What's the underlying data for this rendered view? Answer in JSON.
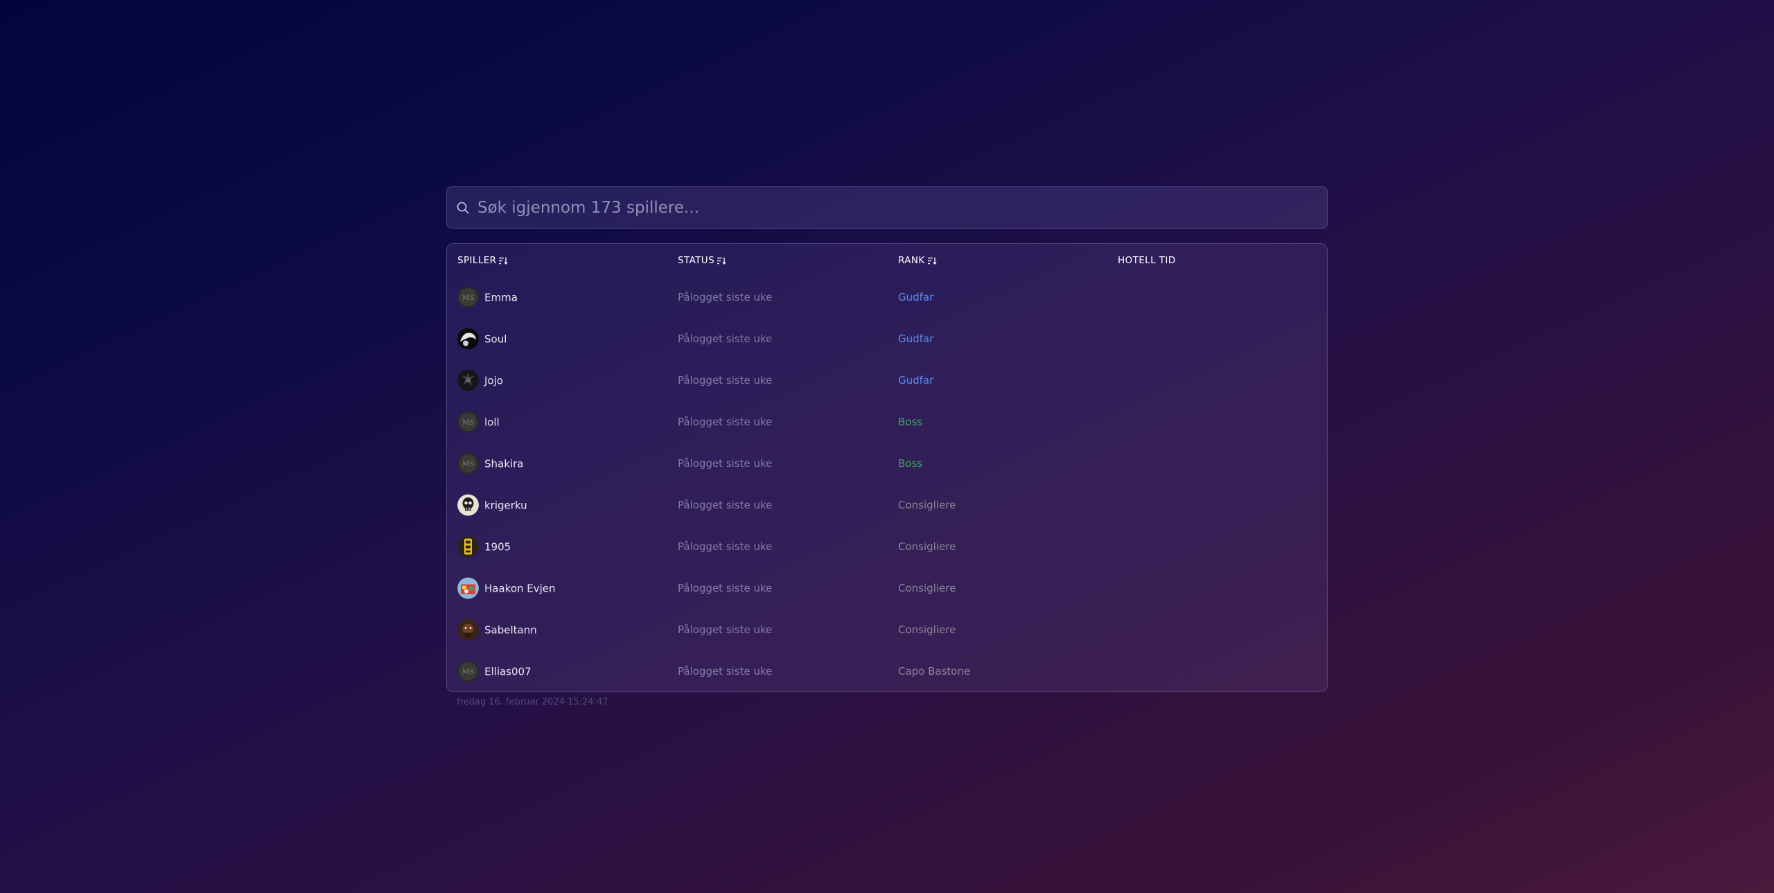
{
  "search": {
    "placeholder": "Søk igjennom 173 spillere..."
  },
  "table": {
    "headers": {
      "player": "SPILLER",
      "status": "STATUS",
      "rank": "RANK",
      "hotel_time": "HOTELL TID"
    },
    "rows": [
      {
        "name": "Emma",
        "status": "Pålogget siste uke",
        "rank": "Gudfar",
        "avatar": "ms-logo"
      },
      {
        "name": "Soul",
        "status": "Pålogget siste uke",
        "rank": "Gudfar",
        "avatar": "custom-white"
      },
      {
        "name": "Jojo",
        "status": "Pålogget siste uke",
        "rank": "Gudfar",
        "avatar": "custom-dark"
      },
      {
        "name": "loll",
        "status": "Pålogget siste uke",
        "rank": "Boss",
        "avatar": "ms-logo"
      },
      {
        "name": "Shakira",
        "status": "Pålogget siste uke",
        "rank": "Boss",
        "avatar": "ms-logo"
      },
      {
        "name": "krigerku",
        "status": "Pålogget siste uke",
        "rank": "Consigliere",
        "avatar": "custom-skull"
      },
      {
        "name": "1905",
        "status": "Pålogget siste uke",
        "rank": "Consigliere",
        "avatar": "custom-yellow"
      },
      {
        "name": "Haakon Evjen",
        "status": "Pålogget siste uke",
        "rank": "Consigliere",
        "avatar": "custom-colorful"
      },
      {
        "name": "Sabeltann",
        "status": "Pålogget siste uke",
        "rank": "Consigliere",
        "avatar": "custom-brown"
      },
      {
        "name": "Ellias007",
        "status": "Pålogget siste uke",
        "rank": "Capo Bastone",
        "avatar": "ms-logo"
      }
    ]
  },
  "timestamp": "fredag 16. februar 2024 15:24:47",
  "colors": {
    "rank_gudfar": "#5b8def",
    "rank_boss": "#3aa85a",
    "rank_consigliere": "#8a8498",
    "rank_capo_bastone": "#8a8498"
  }
}
